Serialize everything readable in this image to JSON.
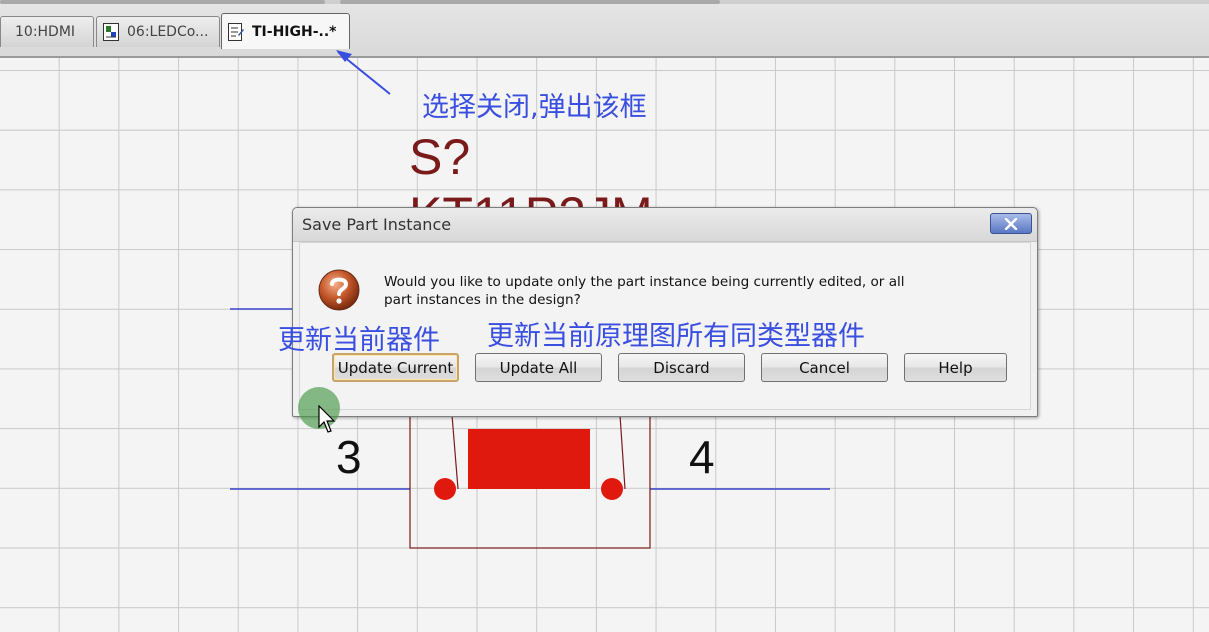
{
  "tabs": [
    {
      "label": "10:HDMI",
      "active": false
    },
    {
      "label": "06:LEDCo...",
      "active": false
    },
    {
      "label": "TI-HIGH-..*",
      "active": true
    }
  ],
  "schematic": {
    "ref_designator": "S?",
    "part_value": "KT11P2JM",
    "pin_left": "3",
    "pin_right": "4",
    "body_color": "#e0190f",
    "wire_color": "#3a44c8",
    "outline_color": "#7a1a1a"
  },
  "annotations": {
    "close_hint": "选择关闭,弹出该框",
    "update_current_hint": "更新当前器件",
    "update_all_hint": "更新当前原理图所有同类型器件",
    "color": "#3a4fe0"
  },
  "dialog": {
    "title": "Save Part Instance",
    "icon": "question-icon",
    "message": "Would you like to update only the part instance being currently edited, or all part instances in the design?",
    "buttons": {
      "update_current": "Update Current",
      "update_all": "Update All",
      "discard": "Discard",
      "cancel": "Cancel",
      "help": "Help"
    },
    "default_button": "Update Current"
  }
}
